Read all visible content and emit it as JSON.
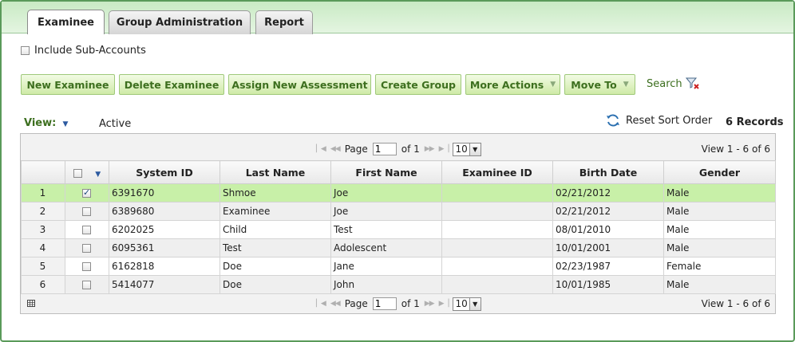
{
  "tabs": [
    {
      "label": "Examinee"
    },
    {
      "label": "Group Administration"
    },
    {
      "label": "Report"
    }
  ],
  "include_sub_accounts": {
    "label": "Include Sub-Accounts",
    "checked": false
  },
  "toolbar": {
    "new_examinee": "New Examinee",
    "delete_examinee": "Delete Examinee",
    "assign_assessment": "Assign New Assessment",
    "create_group": "Create Group",
    "more_actions": "More Actions",
    "move_to": "Move To",
    "search": "Search"
  },
  "view": {
    "label": "View:",
    "value": "Active"
  },
  "reset_sort": "Reset Sort Order",
  "records": "6 Records",
  "pager": {
    "page_label": "Page",
    "page_value": "1",
    "of_label": "of 1",
    "page_size": "10",
    "view_info": "View 1 - 6 of 6"
  },
  "columns": [
    "System ID",
    "Last Name",
    "First Name",
    "Examinee ID",
    "Birth Date",
    "Gender"
  ],
  "rows": [
    {
      "n": "1",
      "checked": true,
      "system_id": "6391670",
      "last": "Shmoe",
      "first": "Joe",
      "exid": "",
      "birth": "02/21/2012",
      "gender": "Male"
    },
    {
      "n": "2",
      "checked": false,
      "system_id": "6389680",
      "last": "Examinee",
      "first": "Joe",
      "exid": "",
      "birth": "02/21/2012",
      "gender": "Male"
    },
    {
      "n": "3",
      "checked": false,
      "system_id": "6202025",
      "last": "Child",
      "first": "Test",
      "exid": "",
      "birth": "08/01/2010",
      "gender": "Male"
    },
    {
      "n": "4",
      "checked": false,
      "system_id": "6095361",
      "last": "Test",
      "first": "Adolescent",
      "exid": "",
      "birth": "10/01/2001",
      "gender": "Male"
    },
    {
      "n": "5",
      "checked": false,
      "system_id": "6162818",
      "last": "Doe",
      "first": "Jane",
      "exid": "",
      "birth": "02/23/1987",
      "gender": "Female"
    },
    {
      "n": "6",
      "checked": false,
      "system_id": "5414077",
      "last": "Doe",
      "first": "John",
      "exid": "",
      "birth": "10/01/1985",
      "gender": "Male"
    }
  ],
  "colors": {
    "accent_green": "#3d6f1f",
    "selected_row": "#c8f0a8",
    "tabbar": "#c9eac4"
  }
}
